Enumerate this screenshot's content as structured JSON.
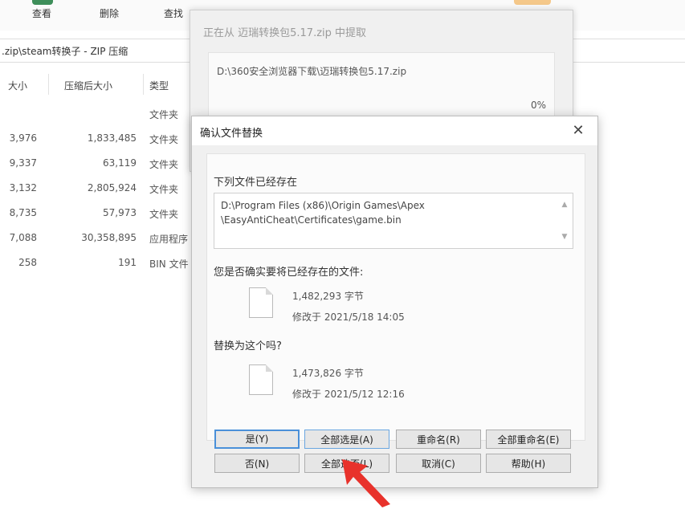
{
  "toolbar": {
    "view_label": "查看",
    "delete_label": "删除",
    "find_label": "查找"
  },
  "path_bar": {
    "text": ".zip\\steam转换子 - ZIP 压缩"
  },
  "file_list": {
    "columns": [
      "大小",
      "压缩后大小",
      "类型"
    ],
    "rows": [
      {
        "size": "",
        "packed": "",
        "type": "文件夹"
      },
      {
        "size": "3,976",
        "packed": "1,833,485",
        "type": "文件夹"
      },
      {
        "size": "9,337",
        "packed": "63,119",
        "type": "文件夹"
      },
      {
        "size": "3,132",
        "packed": "2,805,924",
        "type": "文件夹"
      },
      {
        "size": "8,735",
        "packed": "57,973",
        "type": "文件夹"
      },
      {
        "size": "7,088",
        "packed": "30,358,895",
        "type": "应用程序"
      },
      {
        "size": "258",
        "packed": "191",
        "type": "BIN 文件"
      }
    ]
  },
  "extract_dialog": {
    "title": "正在从 迈瑞转换包5.17.zip 中提取",
    "path": "D:\\360安全浏览器下载\\迈瑞转换包5.17.zip",
    "percent": "0%"
  },
  "confirm_dialog": {
    "title": "确认文件替换",
    "exists_label": "下列文件已经存在",
    "path_line1": "D:\\Program Files (x86)\\Origin Games\\Apex",
    "path_line2": "\\EasyAntiCheat\\Certificates\\game.bin",
    "question": "您是否确实要将已经存在的文件:",
    "existing_size": "1,482,293 字节",
    "existing_modified": "修改于 2021/5/18 14:05",
    "replace_question": "替换为这个吗?",
    "new_size": "1,473,826 字节",
    "new_modified": "修改于 2021/5/12 12:16",
    "buttons": {
      "yes": "是(Y)",
      "yes_all": "全部选是(A)",
      "rename": "重命名(R)",
      "rename_all": "全部重命名(E)",
      "no": "否(N)",
      "no_all": "全部选否(L)",
      "cancel": "取消(C)",
      "help": "帮助(H)"
    }
  },
  "colors": {
    "accent": "#4a90d9",
    "arrow": "#e8322b",
    "dialog_bg": "#f0f0f0"
  }
}
